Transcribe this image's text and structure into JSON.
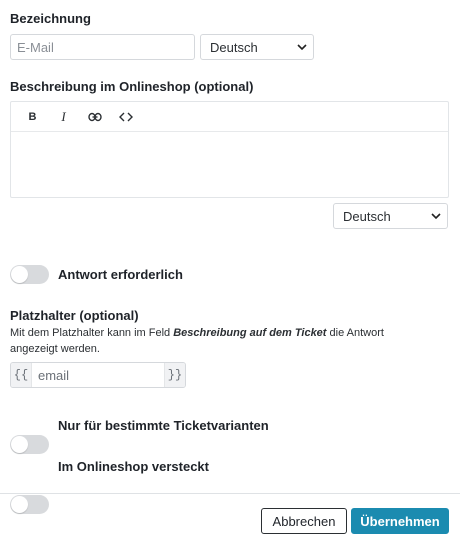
{
  "name_section": {
    "label": "Bezeichnung",
    "input_placeholder": "E-Mail",
    "language_select": "Deutsch"
  },
  "description_section": {
    "label": "Beschreibung im Onlineshop (optional)",
    "toolbar": {
      "bold": "B",
      "italic": "I",
      "link_icon": "link-icon",
      "code_icon": "code-icon"
    },
    "language_select": "Deutsch"
  },
  "answer_required": {
    "label": "Antwort erforderlich",
    "enabled": false
  },
  "placeholder_section": {
    "label": "Platzhalter (optional)",
    "help_prefix": "Mit dem Platzhalter kann im Feld ",
    "help_emphasis": "Beschreibung auf dem Ticket",
    "help_suffix": " die Antwort",
    "help_line2": "angezeigt werden.",
    "prefix": "{{",
    "suffix": "}}",
    "input_placeholder": "email"
  },
  "toggles": {
    "specific_variants": {
      "label": "Nur für bestimmte Ticketvarianten",
      "enabled": false
    },
    "hidden_in_shop": {
      "label": "Im Onlineshop versteckt",
      "enabled": false
    }
  },
  "footer": {
    "cancel_label": "Abbrechen",
    "apply_label": "Übernehmen"
  },
  "colors": {
    "primary": "#1b8bb0",
    "toggle_off": "#d8dadd",
    "border": "#d5d8dc"
  }
}
